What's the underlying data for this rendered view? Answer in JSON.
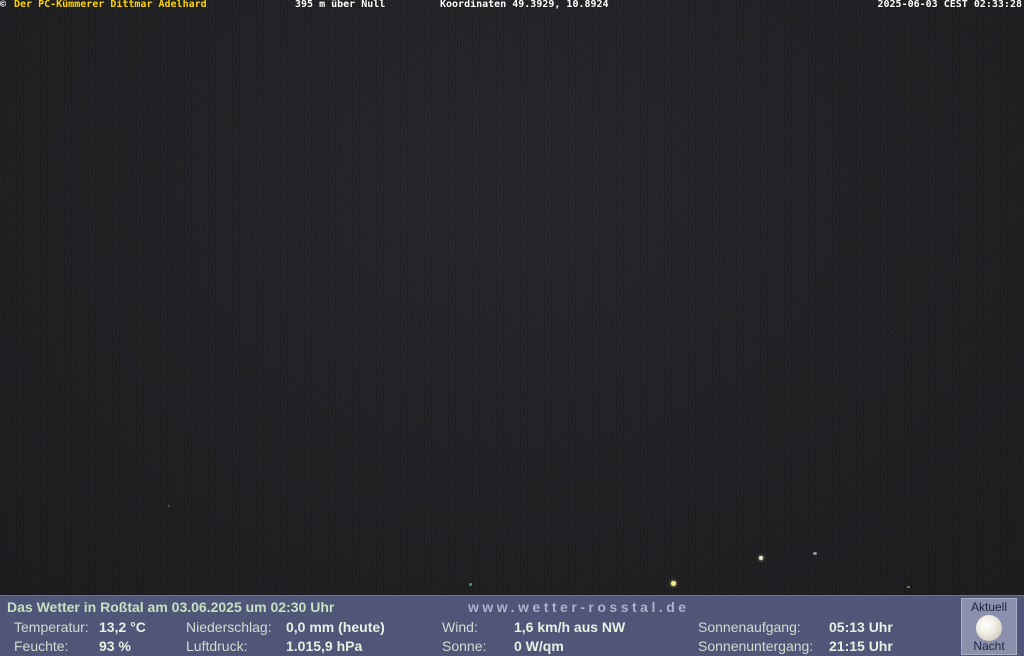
{
  "overlay": {
    "copyright": "©",
    "owner": "Der PC-Kümmerer Dittmar Adelhard",
    "altitude": "395 m über Null",
    "coordinates": "Koordinaten 49.3929, 10.8924",
    "timestamp": "2025-06-03 CEST 02:33:28"
  },
  "weather": {
    "title": "Das Wetter in Roßtal am 03.06.2025 um 02:30 Uhr",
    "site": "www.wetter-rosstal.de",
    "temperature_label": "Temperatur:",
    "temperature_value": "13,2 °C",
    "humidity_label": "Feuchte:",
    "humidity_value": "93 %",
    "precip_label": "Niederschlag:",
    "precip_value": "0,0 mm (heute)",
    "pressure_label": "Luftdruck:",
    "pressure_value": "1.015,9 hPa",
    "wind_label": "Wind:",
    "wind_value": "1,6 km/h aus NW",
    "sun_label": "Sonne:",
    "sun_value": "0 W/qm",
    "sunrise_label": "Sonnenaufgang:",
    "sunrise_value": "05:13 Uhr",
    "sunset_label": "Sonnenuntergang:",
    "sunset_value": "21:15 Uhr",
    "moon_top": "Aktuell",
    "moon_bottom": "Nacht",
    "moon_icon": "moon-icon"
  },
  "colors": {
    "owner_text": "#ffd400",
    "bar_background": "#4f5678"
  }
}
